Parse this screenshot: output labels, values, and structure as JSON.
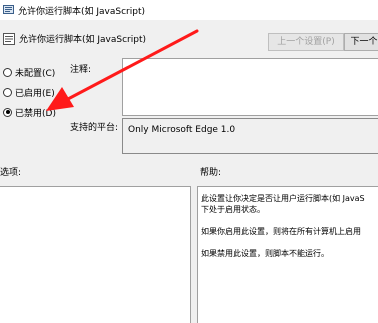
{
  "window": {
    "title": "允许你运行脚本(如 JavaScript)"
  },
  "header": {
    "title": "允许你运行脚本(如 JavaScript)"
  },
  "toolbar": {
    "prev_label": "上一个设置(P)",
    "next_label": "下一个"
  },
  "state": {
    "options": [
      {
        "label": "未配置(C)",
        "checked": false
      },
      {
        "label": "已启用(E)",
        "checked": false
      },
      {
        "label": "已禁用(D)",
        "checked": true
      }
    ]
  },
  "comment": {
    "label": "注释:",
    "value": ""
  },
  "platform": {
    "label": "支持的平台:",
    "value": "Only Microsoft Edge 1.0"
  },
  "sections": {
    "options_label": "选项:",
    "help_label": "帮助:"
  },
  "help": {
    "lines": [
      "此设置让你决定是否让用户运行脚本(如 JavaS",
      "下处于启用状态。",
      "",
      "如果你启用此设置，则将在所有计算机上启用",
      "",
      "如果禁用此设置，则脚本不能运行。"
    ]
  },
  "annotation": {
    "arrow_color": "#ff1a1a"
  },
  "colors": {
    "background": "#f0f0f0",
    "titlebar": "#ffffff"
  }
}
